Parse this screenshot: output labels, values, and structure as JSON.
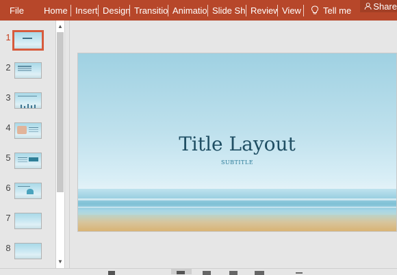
{
  "ribbon": {
    "tabs": [
      "Home",
      "Insert",
      "Design",
      "Transitions",
      "Animations",
      "Slide Show",
      "Review",
      "View"
    ],
    "file_label": "File",
    "tell_me_label": "Tell me",
    "share_label": "Share"
  },
  "thumbnails": [
    {
      "number": "1",
      "selected": true
    },
    {
      "number": "2",
      "selected": false
    },
    {
      "number": "3",
      "selected": false
    },
    {
      "number": "4",
      "selected": false
    },
    {
      "number": "5",
      "selected": false
    },
    {
      "number": "6",
      "selected": false
    },
    {
      "number": "7",
      "selected": false
    },
    {
      "number": "8",
      "selected": false
    }
  ],
  "slide": {
    "title": "Title Layout",
    "subtitle": "SUBTITLE"
  },
  "colors": {
    "ribbon": "#b7472a",
    "accent_selected": "#d75b3d",
    "title_text": "#1f4e63"
  },
  "icons": {
    "tell_me": "lightbulb-icon",
    "share": "person-icon",
    "scroll_up": "triangle-up-icon",
    "scroll_down": "triangle-down-icon"
  }
}
